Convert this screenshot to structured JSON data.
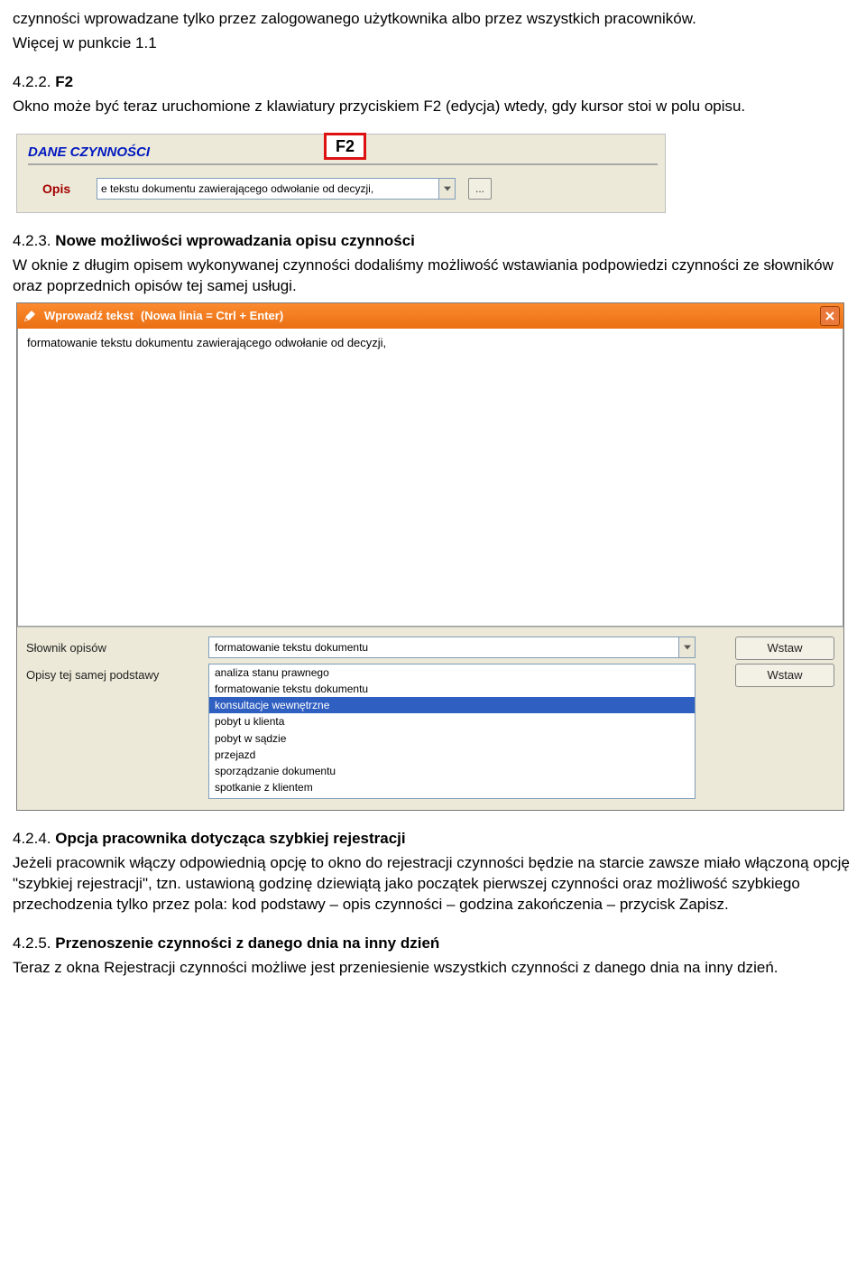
{
  "intro": {
    "p1": "czynności wprowadzane tylko przez zalogowanego użytkownika albo przez wszystkich pracowników.",
    "p2": "Więcej w punkcie 1.1"
  },
  "sec_f2": {
    "num": "4.2.2.",
    "title": "F2",
    "body": "Okno może być teraz uruchomione z klawiatury przyciskiem F2 (edycja) wtedy, gdy kursor stoi w polu opisu."
  },
  "sec_nowe": {
    "num": "4.2.3.",
    "title": "Nowe możliwości wprowadzania opisu czynności",
    "body": "W oknie z długim opisem wykonywanej czynności dodaliśmy możliwość wstawiania podpowiedzi czynności ze słowników oraz poprzednich opisów tej samej usługi."
  },
  "sec_opcja": {
    "num": "4.2.4.",
    "title": "Opcja pracownika dotycząca szybkiej rejestracji",
    "body": "Jeżeli pracownik włączy odpowiednią opcję to okno do rejestracji czynności będzie na starcie zawsze miało włączoną opcję \"szybkiej rejestracji\", tzn. ustawioną godzinę dziewiątą jako początek pierwszej czynności oraz możliwość szybkiego przechodzenia tylko przez pola: kod podstawy – opis czynności – godzina zakończenia – przycisk Zapisz."
  },
  "sec_przen": {
    "num": "4.2.5.",
    "title": "Przenoszenie czynności z danego dnia na inny dzień",
    "body": "Teraz z okna Rejestracji czynności możliwe jest przeniesienie wszystkich czynności z danego dnia na inny dzień."
  },
  "shot1": {
    "panel_title": "DANE CZYNNOŚCI",
    "label": "Opis",
    "input_value": "e tekstu dokumentu zawierającego odwołanie od decyzji,",
    "ellipsis": "...",
    "badge": "F2"
  },
  "shot2": {
    "title": "Wprowadź tekst",
    "subtitle": "(Nowa linia = Ctrl + Enter)",
    "text_value": "formatowanie tekstu dokumentu zawierającego odwołanie od decyzji,",
    "label_slownik": "Słownik opisów",
    "combo_value": "formatowanie tekstu dokumentu",
    "label_opisy": "Opisy tej samej podstawy",
    "btn_wstaw": "Wstaw",
    "list": [
      "analiza stanu prawnego",
      "formatowanie tekstu dokumentu",
      "konsultacje wewnętrzne",
      "pobyt u klienta",
      "pobyt w sądzie",
      "przejazd",
      "sporządzanie dokumentu",
      "spotkanie z klientem"
    ],
    "selected_index": 2
  }
}
